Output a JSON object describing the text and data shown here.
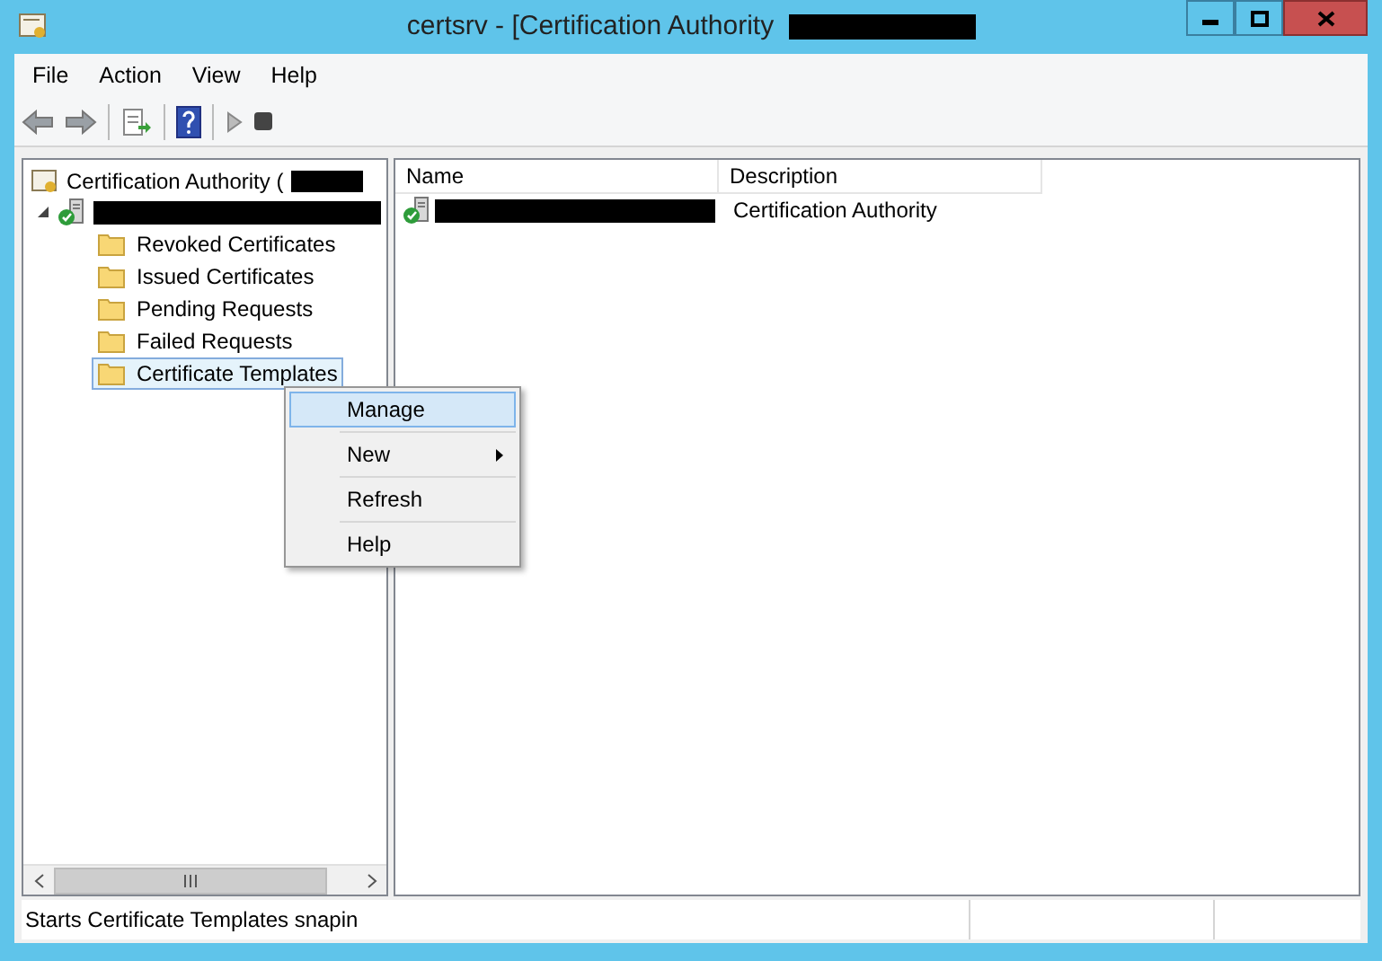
{
  "window": {
    "title": "certsrv - [Certification Authority"
  },
  "menu_bar": [
    "File",
    "Action",
    "View",
    "Help"
  ],
  "tree": {
    "root_label": "Certification Authority (",
    "server_expanded": true,
    "children": [
      {
        "label": "Revoked Certificates",
        "selected": false
      },
      {
        "label": "Issued Certificates",
        "selected": false
      },
      {
        "label": "Pending Requests",
        "selected": false
      },
      {
        "label": "Failed Requests",
        "selected": false
      },
      {
        "label": "Certificate Templates",
        "selected": true
      }
    ]
  },
  "context_menu": [
    {
      "label": "Manage",
      "selected": true,
      "submenu": false
    },
    {
      "label": "New",
      "selected": false,
      "submenu": true
    },
    {
      "label": "Refresh",
      "selected": false,
      "submenu": false
    },
    {
      "label": "Help",
      "selected": false,
      "submenu": false
    }
  ],
  "table": {
    "columns": [
      "Name",
      "Description"
    ],
    "rows": [
      {
        "description": "Certification Authority"
      }
    ]
  },
  "status_bar": "Starts Certificate Templates snapin"
}
